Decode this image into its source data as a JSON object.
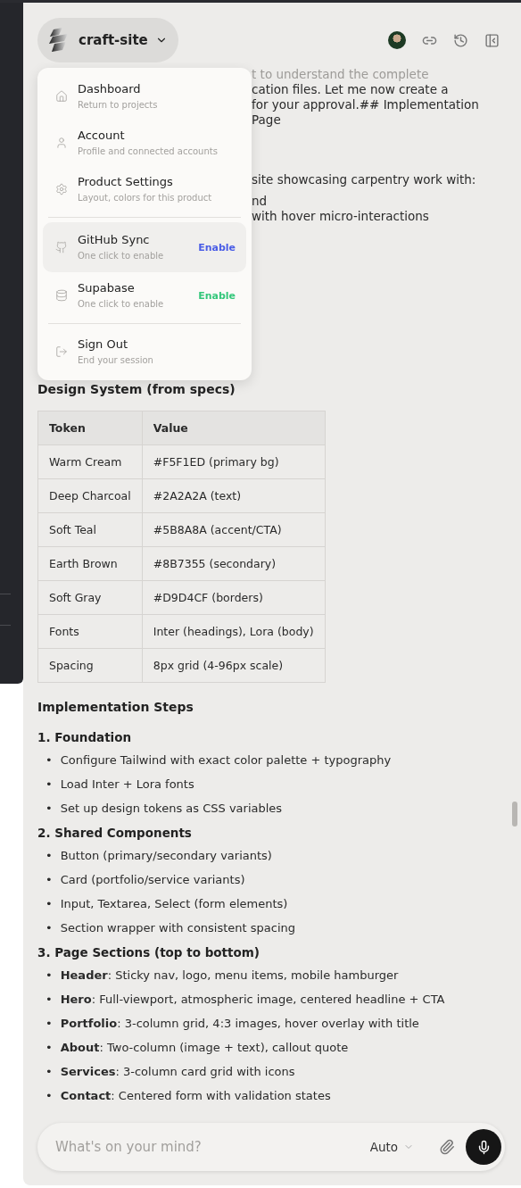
{
  "project": {
    "name": "craft-site"
  },
  "menu": {
    "groups": [
      [
        {
          "title": "Dashboard",
          "subtitle": "Return to projects",
          "highlighted": false
        },
        {
          "title": "Account",
          "subtitle": "Profile and connected accounts",
          "highlighted": false
        },
        {
          "title": "Product Settings",
          "subtitle": "Layout, colors for this product",
          "highlighted": false
        }
      ],
      [
        {
          "title": "GitHub Sync",
          "subtitle": "One click to enable",
          "action": "Enable",
          "color": "#4a5de6",
          "highlighted": true
        },
        {
          "title": "Supabase",
          "subtitle": "One click to enable",
          "action": "Enable",
          "color": "#34c77b",
          "highlighted": false
        }
      ],
      [
        {
          "title": "Sign Out",
          "subtitle": "End your session",
          "highlighted": false
        }
      ]
    ]
  },
  "background_text": [
    {
      "lines": [
        {
          "text": "t to understand the complete",
          "faded": true
        },
        {
          "text": "cation files. Let me now create a",
          "faded": false
        },
        {
          "text": "for your approval.## Implementation",
          "faded": false
        },
        {
          "text": "Page",
          "faded": false
        }
      ]
    },
    {
      "lines": [
        {
          "text": "site showcasing carpentry work with:",
          "faded": false
        }
      ]
    },
    {
      "lines": [
        {
          "text": "nd",
          "faded": false
        },
        {
          "text": "with hover micro-interactions",
          "faded": false
        }
      ]
    }
  ],
  "content": [
    {
      "kind": "heading",
      "text": "Design System (from specs)"
    },
    {
      "kind": "table",
      "columns": [
        "Token",
        "Value"
      ],
      "rows": [
        [
          "Warm Cream",
          "#F5F1ED (primary bg)"
        ],
        [
          "Deep Charcoal",
          "#2A2A2A (text)"
        ],
        [
          "Soft Teal",
          "#5B8A8A (accent/CTA)"
        ],
        [
          "Earth Brown",
          "#8B7355 (secondary)"
        ],
        [
          "Soft Gray",
          "#D9D4CF (borders)"
        ],
        [
          "Fonts",
          "Inter (headings), Lora (body)"
        ],
        [
          "Spacing",
          "8px grid (4-96px scale)"
        ]
      ]
    },
    {
      "kind": "heading",
      "text": "Implementation Steps"
    },
    {
      "kind": "subheading",
      "text": "1. Foundation"
    },
    {
      "kind": "list",
      "marker": "•",
      "items": [
        "Configure Tailwind with exact color palette + typography",
        "Load Inter + Lora fonts",
        "Set up design tokens as CSS variables"
      ]
    },
    {
      "kind": "subheading",
      "text": "2. Shared Components"
    },
    {
      "kind": "list",
      "marker": "•",
      "items": [
        "Button (primary/secondary variants)",
        "Card (portfolio/service variants)",
        "Input, Textarea, Select (form elements)",
        "Section wrapper with consistent spacing"
      ]
    },
    {
      "kind": "subheading",
      "text": "3. Page Sections (top to bottom)"
    },
    {
      "kind": "list",
      "marker": "•",
      "items": [
        "**Header**: Sticky nav, logo, menu items, mobile hamburger",
        "**Hero**: Full-viewport, atmospheric image, centered headline + CTA",
        "**Portfolio**: 3-column grid, 4:3 images, hover overlay with title",
        "**About**: Two-column (image + text), callout quote",
        "**Services**: 3-column card grid with icons",
        "**Contact**: Centered form with validation states"
      ]
    }
  ],
  "composer": {
    "placeholder": "What's on your mind?",
    "mode": "Auto"
  }
}
